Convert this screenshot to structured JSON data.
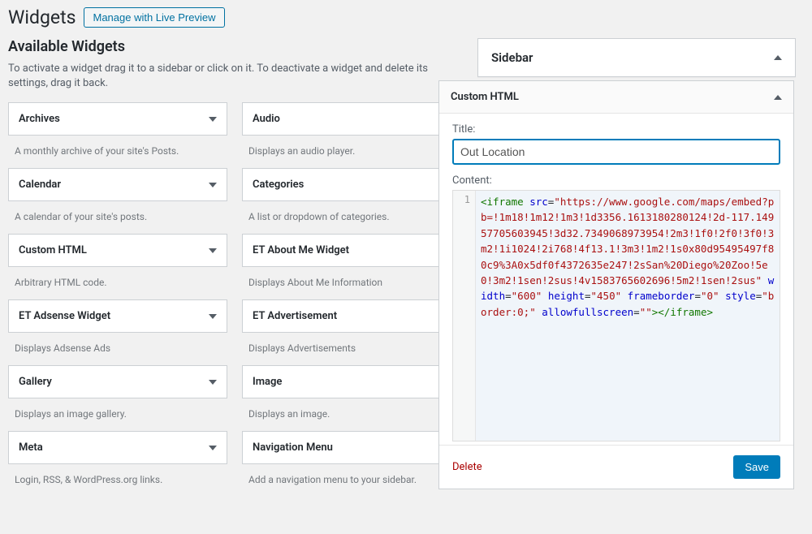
{
  "page": {
    "title": "Widgets",
    "live_preview": "Manage with Live Preview",
    "section_h": "Available Widgets",
    "section_desc": "To activate a widget drag it to a sidebar or click on it. To deactivate a widget and delete its settings, drag it back."
  },
  "widgets_left": [
    {
      "name": "Archives",
      "desc": "A monthly archive of your site's Posts."
    },
    {
      "name": "Calendar",
      "desc": "A calendar of your site's posts."
    },
    {
      "name": "Custom HTML",
      "desc": "Arbitrary HTML code."
    },
    {
      "name": "ET Adsense Widget",
      "desc": "Displays Adsense Ads"
    },
    {
      "name": "Gallery",
      "desc": "Displays an image gallery."
    },
    {
      "name": "Meta",
      "desc": "Login, RSS, & WordPress.org links."
    }
  ],
  "widgets_right": [
    {
      "name": "Audio",
      "desc": "Displays an audio player."
    },
    {
      "name": "Categories",
      "desc": "A list or dropdown of categories."
    },
    {
      "name": "ET About Me Widget",
      "desc": "Displays About Me Information"
    },
    {
      "name": "ET Advertisement",
      "desc": "Displays Advertisements"
    },
    {
      "name": "Image",
      "desc": "Displays an image."
    },
    {
      "name": "Navigation Menu",
      "desc": "Add a navigation menu to your sidebar."
    }
  ],
  "sidebar": {
    "title": "Sidebar",
    "widget_title": "Custom HTML",
    "title_label": "Title:",
    "title_value": "Out Location",
    "content_label": "Content:",
    "code_tag": "iframe",
    "code_attrs": {
      "src": "https://www.google.com/maps/embed?pb=!1m18!1m12!1m3!1d3356.1613180280124!2d-117.14957705603945!3d32.7349068973954!2m3!1f0!2f0!3f0!3m2!1i1024!2i768!4f13.1!3m3!1m2!1s0x80d95495497f80c9%3A0x5df0f4372635e247!2sSan%20Diego%20Zoo!5e0!3m2!1sen!2sus!4v1583765602696!5m2!1sen!2sus",
      "width": "600",
      "height": "450",
      "frameborder": "0",
      "style": "border:0;",
      "allowfullscreen": ""
    },
    "line_no": "1",
    "delete_label": "Delete",
    "save_label": "Save"
  }
}
